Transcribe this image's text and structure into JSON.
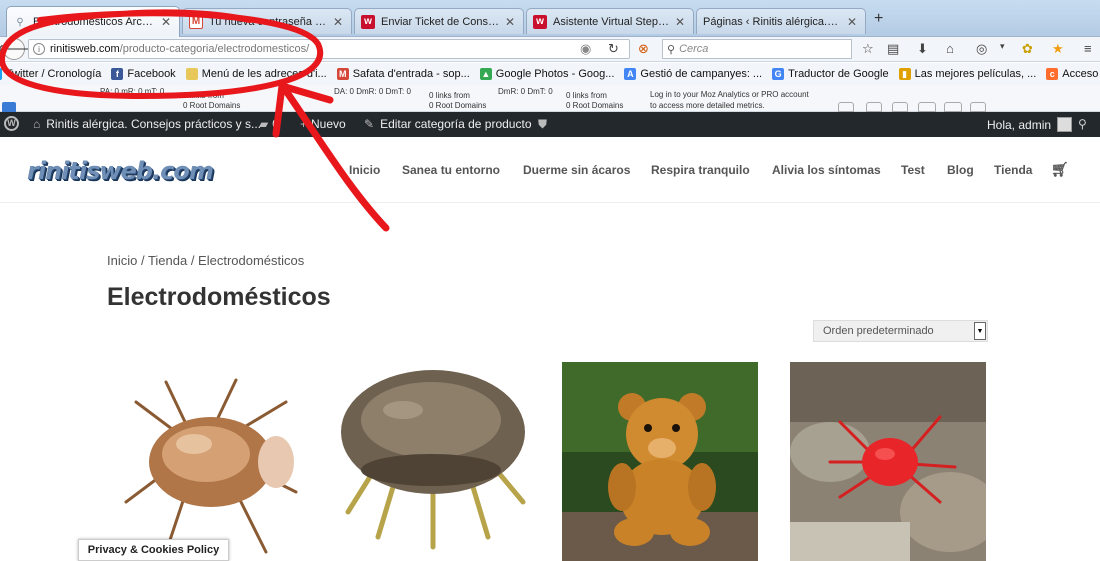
{
  "browser": {
    "tabs": [
      {
        "label": "Electrodomésticos Archivos ...",
        "favicon": "firefox-page-icon",
        "active": true
      },
      {
        "label": "Tu nueva contraseña para ...",
        "favicon": "gmail-icon",
        "active": false
      },
      {
        "label": "Enviar Ticket de Consulta - ...",
        "favicon": "webempresa-icon",
        "active": false
      },
      {
        "label": "Asistente Virtual Stephan 1....",
        "favicon": "webempresa-icon",
        "active": false
      },
      {
        "label": "Páginas ‹ Rinitis alérgica. Cons...",
        "favicon": "wordpress-icon",
        "active": false
      }
    ],
    "new_tab": "+",
    "url_host": "rinitisweb.com",
    "url_path": "/producto-categoria/electrodomesticos/",
    "search_placeholder": "Cerca",
    "bookmarks": [
      {
        "label": "Twitter / Cronología",
        "icon": "twitter-icon",
        "color": "#1da1f2"
      },
      {
        "label": "Facebook",
        "icon": "facebook-icon",
        "color": "#3b5998"
      },
      {
        "label": "Menú de les adreces d'i...",
        "icon": "folder-icon",
        "color": "#e8c85a"
      },
      {
        "label": "Safata d'entrada - sop...",
        "icon": "gmail-icon",
        "color": "#d44638"
      },
      {
        "label": "Google Photos - Goog...",
        "icon": "google-drive-icon",
        "color": "#34a853"
      },
      {
        "label": "Gestió de campanyes: ...",
        "icon": "adwords-icon",
        "color": "#4285f4"
      },
      {
        "label": "Traductor de Google",
        "icon": "translate-icon",
        "color": "#4285f4"
      },
      {
        "label": "Las mejores películas, ...",
        "icon": "movie-icon",
        "color": "#e0a000"
      },
      {
        "label": "Acceso a correo web d...",
        "icon": "cpanel-icon",
        "color": "#ff6c2c"
      }
    ]
  },
  "mozbar": {
    "metrics1": "PA: 0   mR: 0   mT: 0",
    "links1a": "0 links from",
    "links1b": "0 Root Domains",
    "metrics2": "DA: 0   DmR: 0   DmT: 0",
    "links2a": "0 links from",
    "links2b": "0 Root Domains",
    "metrics3": "DmR: 0   DmT: 0",
    "links3a": "0 links from",
    "links3b": "0 Root Domains",
    "login1": "Log in to your Moz Analytics or PRO account",
    "login2": "to access more detailed metrics."
  },
  "adminbar": {
    "site_name": "Rinitis alérgica. Consejos prácticos y s...",
    "comments_count": "0",
    "new_label": "Nuevo",
    "edit_label": "Editar categoría de producto",
    "greeting": "Hola, admin"
  },
  "site": {
    "logo_text": "rinitisweb.com",
    "menu": [
      "Inicio",
      "Sanea tu entorno",
      "Duerme sin ácaros",
      "Respira tranquilo",
      "Alivia los síntomas",
      "Test",
      "Blog",
      "Tienda"
    ]
  },
  "content": {
    "breadcrumb": "Inicio / Tienda / Electrodomésticos",
    "title": "Electrodomésticos",
    "orderby": "Orden predeterminado",
    "privacy": "Privacy & Cookies Policy"
  },
  "colors": {
    "admin_bar": "#23282d",
    "annotation_red": "#e8171b"
  }
}
